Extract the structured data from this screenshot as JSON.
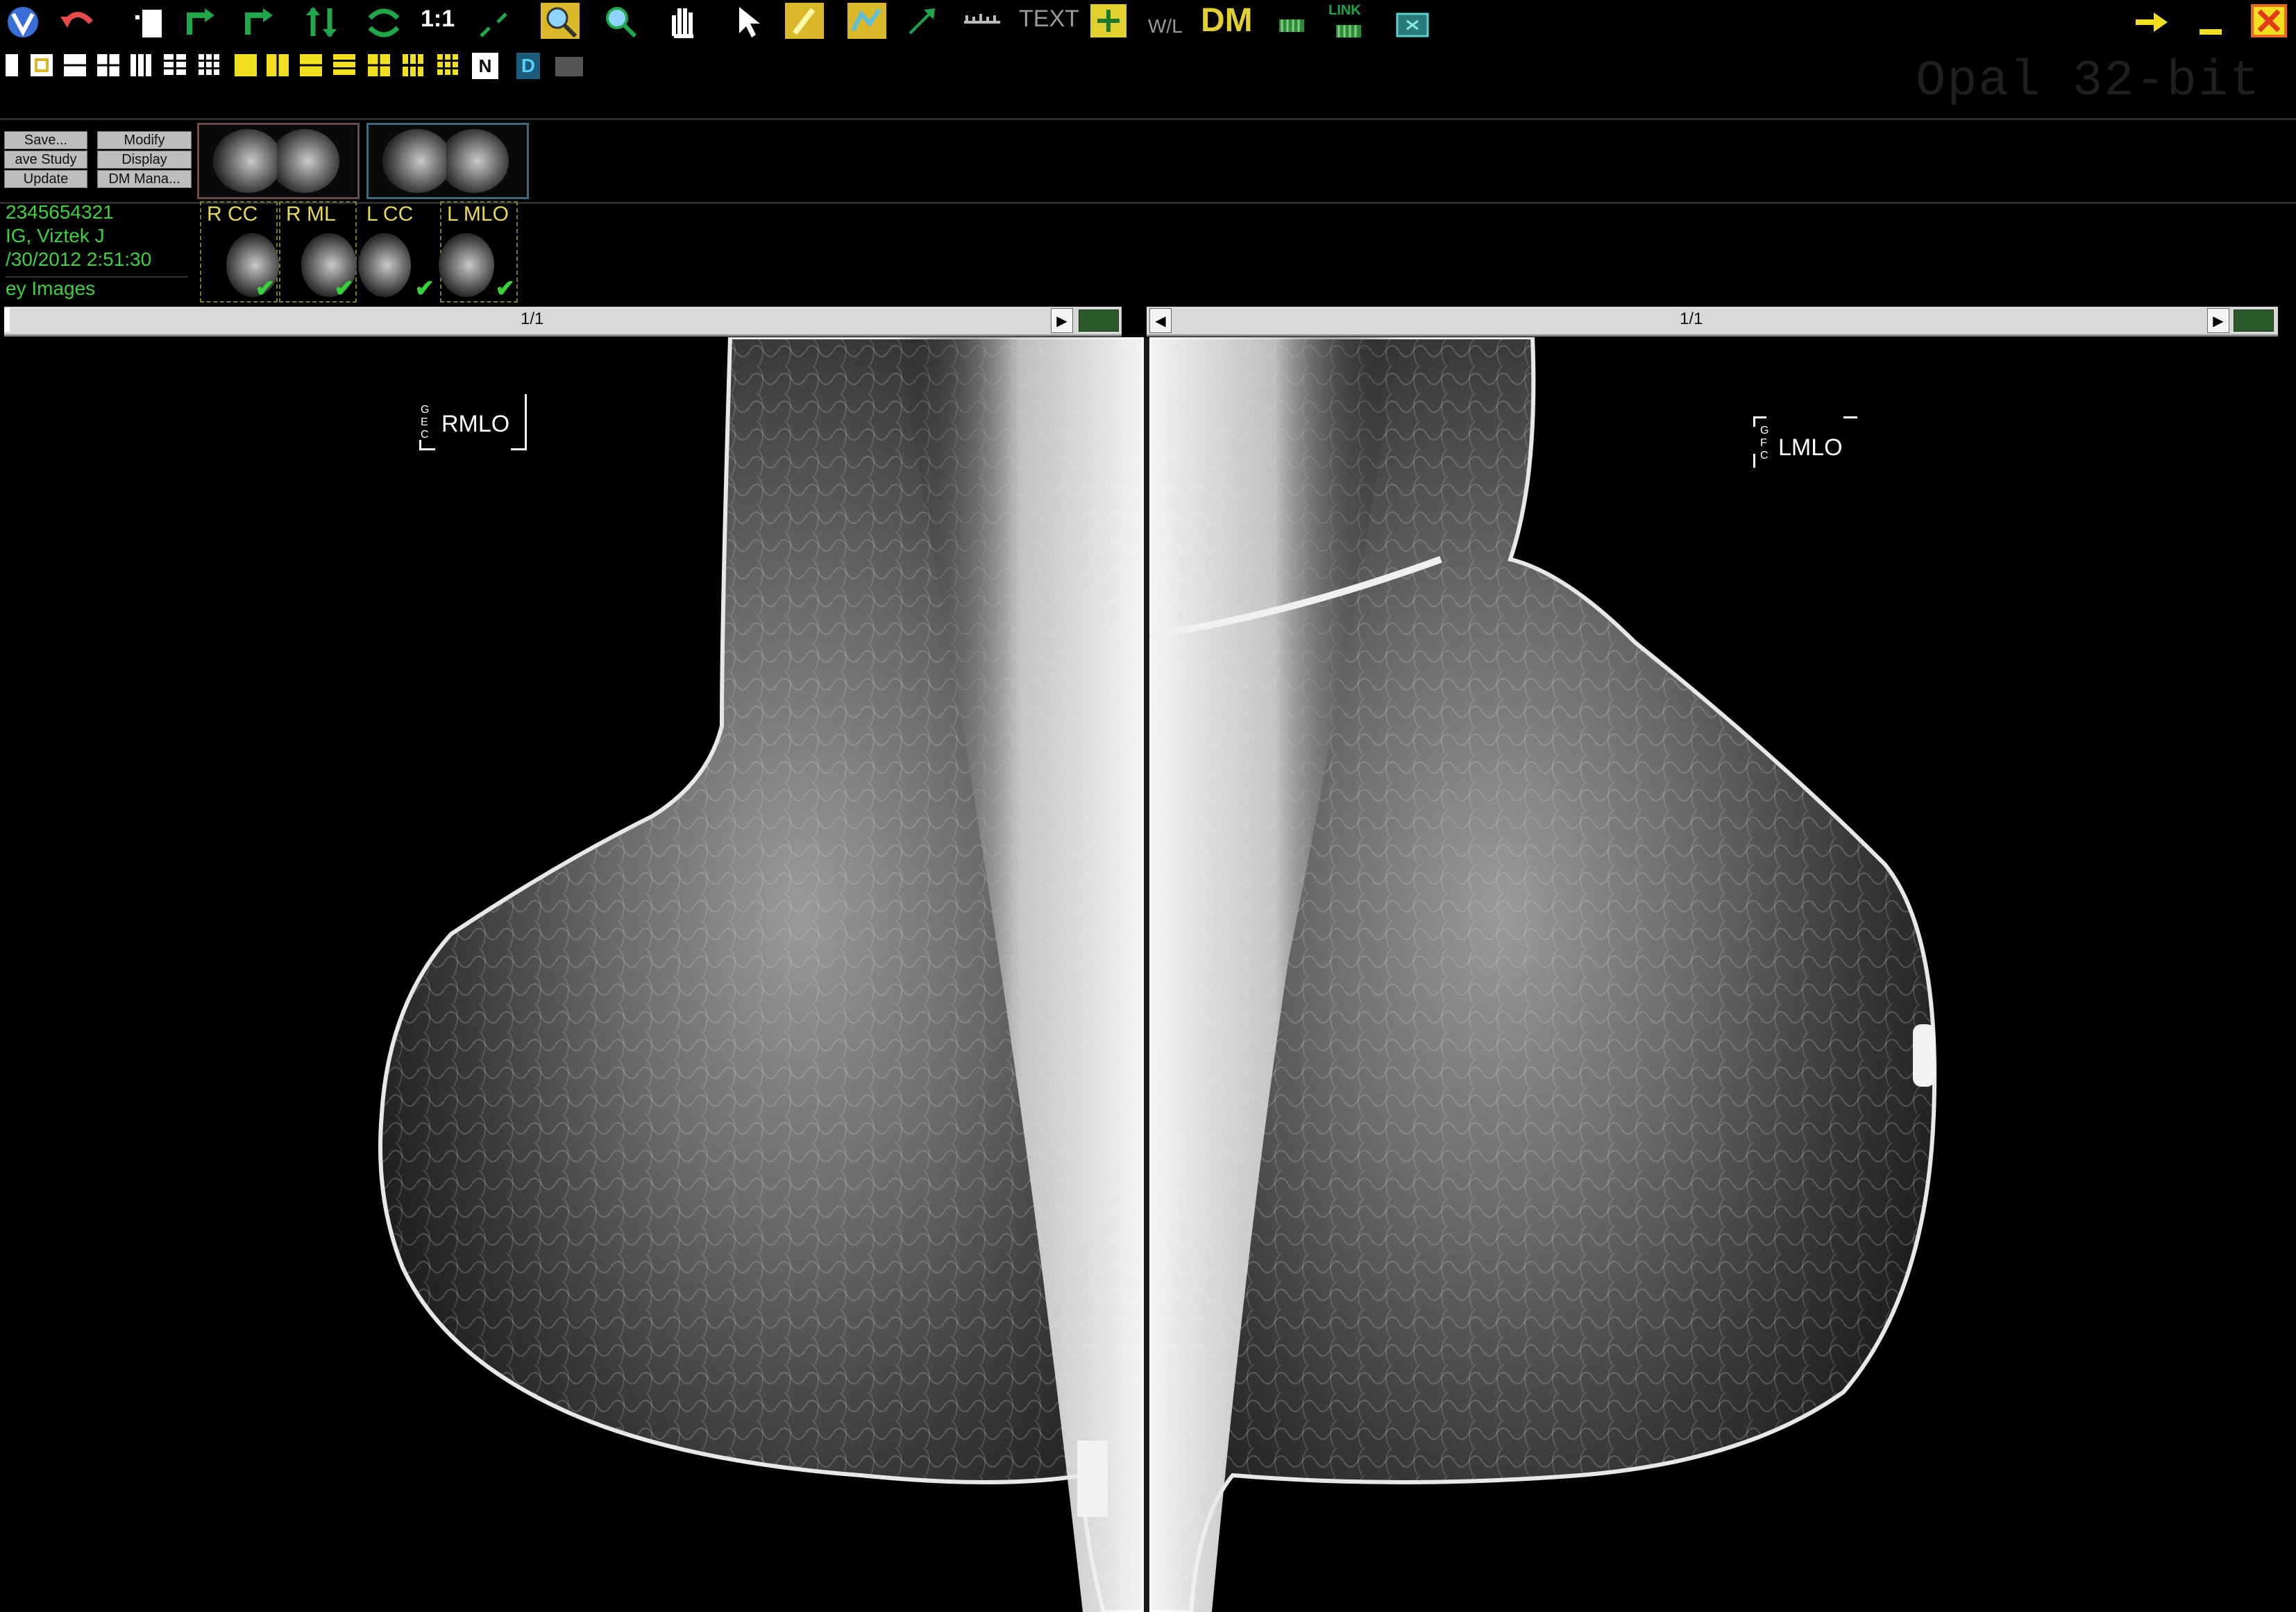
{
  "toolbar": {
    "text_tool": "TEXT",
    "wl_tool": "W/L",
    "dm_tool": "DM",
    "link_tool": "LINK",
    "one_to_one": "1:1",
    "n_badge": "N",
    "d_badge": "D"
  },
  "watermark": "Opal 32-bit",
  "study_buttons": {
    "save": "Save...",
    "modify": "Modify",
    "save_study": "ave Study",
    "display": "Display",
    "update": "Update",
    "dm_manager": "DM Mana..."
  },
  "patient": {
    "id": "2345654321",
    "name": "IG, Viztek J",
    "datetime": "/30/2012 2:51:30",
    "key_images": "ey Images"
  },
  "series": [
    {
      "label": "R CC",
      "checked": true
    },
    {
      "label": "R ML",
      "checked": true
    },
    {
      "label": "L CC",
      "checked": true
    },
    {
      "label": "L MLO",
      "checked": true
    }
  ],
  "viewports": {
    "left": {
      "page": "1/1",
      "view_label": "RMLO",
      "markers": "G\nE\nC"
    },
    "right": {
      "page": "1/1",
      "view_label": "LMLO",
      "markers": "G\nF\nC"
    }
  },
  "colors": {
    "patient_text": "#3fd13f",
    "series_label": "#e8d85a",
    "check": "#37d13a",
    "accent_yellow": "#f0e020"
  }
}
